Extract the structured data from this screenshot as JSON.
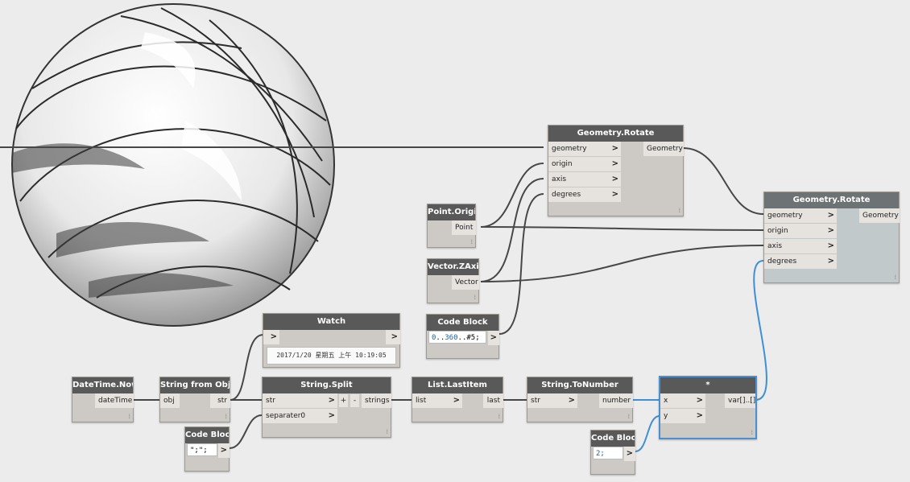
{
  "nodes": {
    "rotate1": {
      "title": "Geometry.Rotate",
      "in": [
        "geometry",
        "origin",
        "axis",
        "degrees"
      ],
      "out": "Geometry"
    },
    "rotate2": {
      "title": "Geometry.Rotate",
      "in": [
        "geometry",
        "origin",
        "axis",
        "degrees"
      ],
      "out": "Geometry"
    },
    "point_origin": {
      "title": "Point.Origin",
      "out": "Point"
    },
    "vector_z": {
      "title": "Vector.ZAxis",
      "out": "Vector"
    },
    "code1": {
      "title": "Code Block",
      "code_a": "0",
      "code_b": "..",
      "code_c": "360",
      "code_d": "..#5;"
    },
    "watch": {
      "title": "Watch",
      "value": "2017/1/20 星期五 上午 10:19:05"
    },
    "datetime_now": {
      "title": "DateTime.Now",
      "out": "dateTime"
    },
    "string_from_obj": {
      "title": "String from Object",
      "in": "obj",
      "out": "str"
    },
    "code2": {
      "title": "Code Block",
      "code": "\";\";"
    },
    "string_split": {
      "title": "String.Split",
      "in": [
        "str",
        "separater0"
      ],
      "plus": "+",
      "minus": "-",
      "out": "strings"
    },
    "list_last": {
      "title": "List.LastItem",
      "in": "list",
      "out": "last"
    },
    "to_number": {
      "title": "String.ToNumber",
      "in": "str",
      "out": "number"
    },
    "code3": {
      "title": "Code Block",
      "code": "2;"
    },
    "multiply": {
      "title": "*",
      "in": [
        "x",
        "y"
      ],
      "out": "var[]..[]"
    }
  },
  "ui": {
    "chevron": ">",
    "grip": "⁞",
    "wire_color": "#474747",
    "selected_wire_color": "#3d8fd6"
  }
}
